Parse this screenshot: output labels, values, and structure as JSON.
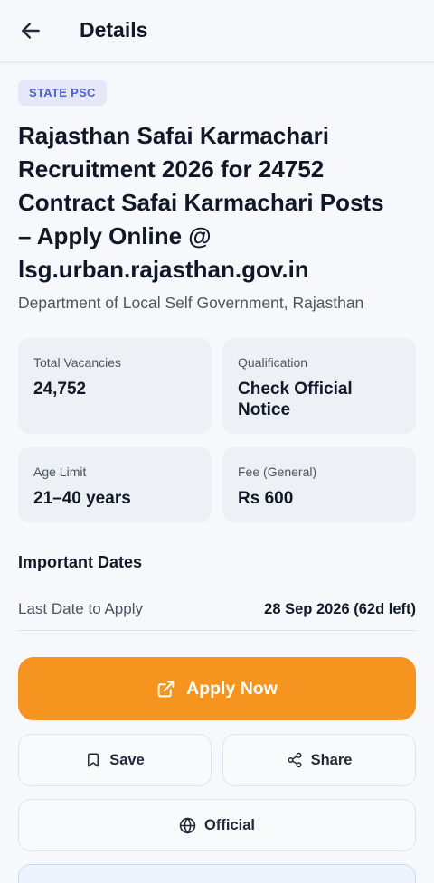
{
  "header": {
    "title": "Details",
    "back_icon": "arrow-left-icon"
  },
  "job": {
    "category": "STATE PSC",
    "title": "Rajasthan Safai Karmachari Recruitment 2026 for 24752 Contract Safai Karmachari Posts – Apply Online @ lsg.urban.rajasthan.gov.in",
    "department": "Department of Local Self Government, Rajasthan"
  },
  "stats": [
    {
      "label": "Total Vacancies",
      "value": "24,752"
    },
    {
      "label": "Qualification",
      "value": "Check Official Notice"
    },
    {
      "label": "Age Limit",
      "value": "21–40 years"
    },
    {
      "label": "Fee (General)",
      "value": "Rs 600"
    }
  ],
  "dates": {
    "section_title": "Important Dates",
    "rows": [
      {
        "label": "Last Date to Apply",
        "value": "28 Sep 2026 (62d left)"
      }
    ]
  },
  "actions": {
    "apply_label": "Apply Now",
    "save_label": "Save",
    "share_label": "Share",
    "official_label": "Official"
  },
  "icons": {
    "apply": "external-link-icon",
    "save": "bookmark-icon",
    "share": "share-icon",
    "official": "globe-icon"
  },
  "colors": {
    "accent": "#f5941f",
    "badge_bg": "#e4e8f8",
    "badge_text": "#4f5fcf",
    "background": "#f6f8fb"
  }
}
